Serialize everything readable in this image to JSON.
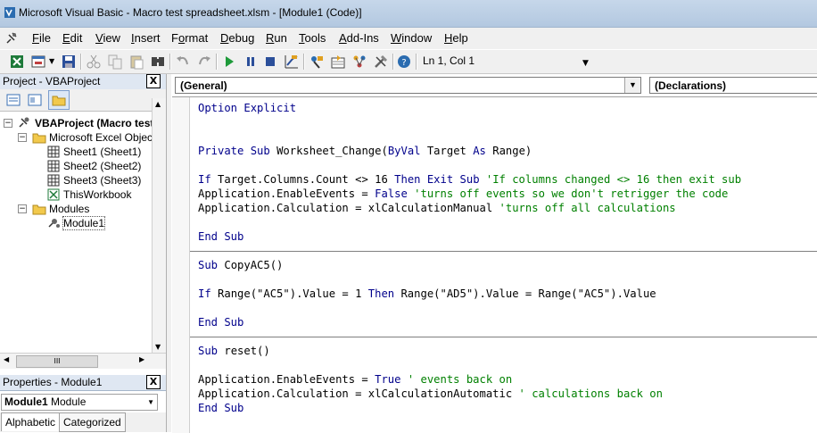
{
  "window": {
    "title": "Microsoft Visual Basic - Macro test spreadsheet.xlsm - [Module1 (Code)]"
  },
  "menu": [
    {
      "pre": "",
      "u": "F",
      "post": "ile"
    },
    {
      "pre": "",
      "u": "E",
      "post": "dit"
    },
    {
      "pre": "",
      "u": "V",
      "post": "iew"
    },
    {
      "pre": "",
      "u": "I",
      "post": "nsert"
    },
    {
      "pre": "F",
      "u": "o",
      "post": "rmat"
    },
    {
      "pre": "",
      "u": "D",
      "post": "ebug"
    },
    {
      "pre": "",
      "u": "R",
      "post": "un"
    },
    {
      "pre": "",
      "u": "T",
      "post": "ools"
    },
    {
      "pre": "",
      "u": "A",
      "post": "dd-Ins"
    },
    {
      "pre": "",
      "u": "W",
      "post": "indow"
    },
    {
      "pre": "",
      "u": "H",
      "post": "elp"
    }
  ],
  "toolbar": {
    "position": "Ln 1, Col 1"
  },
  "project": {
    "title": "Project - VBAProject",
    "close": "X",
    "tree": [
      {
        "label": "VBAProject (Macro test",
        "bold": true,
        "icon": "vbaproject-icon",
        "expander": "−"
      },
      {
        "label": "Microsoft Excel Objects",
        "icon": "folder-icon",
        "expander": "−"
      },
      {
        "label": "Sheet1 (Sheet1)",
        "icon": "sheet-icon"
      },
      {
        "label": "Sheet2 (Sheet2)",
        "icon": "sheet-icon"
      },
      {
        "label": "Sheet3 (Sheet3)",
        "icon": "sheet-icon"
      },
      {
        "label": "ThisWorkbook",
        "icon": "workbook-icon"
      },
      {
        "label": "Modules",
        "icon": "folder-icon",
        "expander": "−"
      },
      {
        "label": "Module1",
        "icon": "module-icon",
        "selected": true
      }
    ],
    "hscroll_thumb": "III"
  },
  "properties": {
    "title": "Properties - Module1",
    "close": "X",
    "object_name": "Module1",
    "object_type": "Module",
    "tabs": [
      "Alphabetic",
      "Categorized"
    ]
  },
  "code": {
    "object_combo": "(General)",
    "proc_combo": "(Declarations)",
    "lines": [
      [
        {
          "t": "Option Explicit",
          "c": "kw"
        }
      ],
      [],
      [],
      [
        {
          "t": "Private Sub ",
          "c": "kw"
        },
        {
          "t": "Worksheet_Change("
        },
        {
          "t": "ByVal ",
          "c": "kw"
        },
        {
          "t": "Target "
        },
        {
          "t": "As ",
          "c": "kw"
        },
        {
          "t": "Range)"
        }
      ],
      [],
      [
        {
          "t": "If ",
          "c": "kw"
        },
        {
          "t": "Target.Columns.Count <> 16 "
        },
        {
          "t": "Then Exit Sub ",
          "c": "kw"
        },
        {
          "t": "'If columns changed <> 16 then exit sub",
          "c": "cm"
        }
      ],
      [
        {
          "t": "Application.EnableEvents = "
        },
        {
          "t": "False ",
          "c": "kw"
        },
        {
          "t": "'turns off events so we don't retrigger the code",
          "c": "cm"
        }
      ],
      [
        {
          "t": "Application.Calculation = xlCalculationManual "
        },
        {
          "t": "'turns off all calculations",
          "c": "cm"
        }
      ],
      [],
      [
        {
          "t": "End Sub",
          "c": "kw"
        }
      ],
      [
        {
          "sep": true
        }
      ],
      [
        {
          "t": "Sub ",
          "c": "kw"
        },
        {
          "t": "CopyAC5()"
        }
      ],
      [],
      [
        {
          "t": "If ",
          "c": "kw"
        },
        {
          "t": "Range(\"AC5\").Value = 1 "
        },
        {
          "t": "Then ",
          "c": "kw"
        },
        {
          "t": "Range(\"AD5\").Value = Range(\"AC5\").Value"
        }
      ],
      [],
      [
        {
          "t": "End Sub",
          "c": "kw"
        }
      ],
      [
        {
          "sep": true
        }
      ],
      [
        {
          "t": "Sub ",
          "c": "kw"
        },
        {
          "t": "reset()"
        }
      ],
      [],
      [
        {
          "t": "Application.EnableEvents = "
        },
        {
          "t": "True ",
          "c": "kw"
        },
        {
          "t": "' events back on",
          "c": "cm"
        }
      ],
      [
        {
          "t": "Application.Calculation = xlCalculationAutomatic "
        },
        {
          "t": "' calculations back on",
          "c": "cm"
        }
      ],
      [
        {
          "t": "End Sub",
          "c": "kw"
        }
      ]
    ]
  }
}
